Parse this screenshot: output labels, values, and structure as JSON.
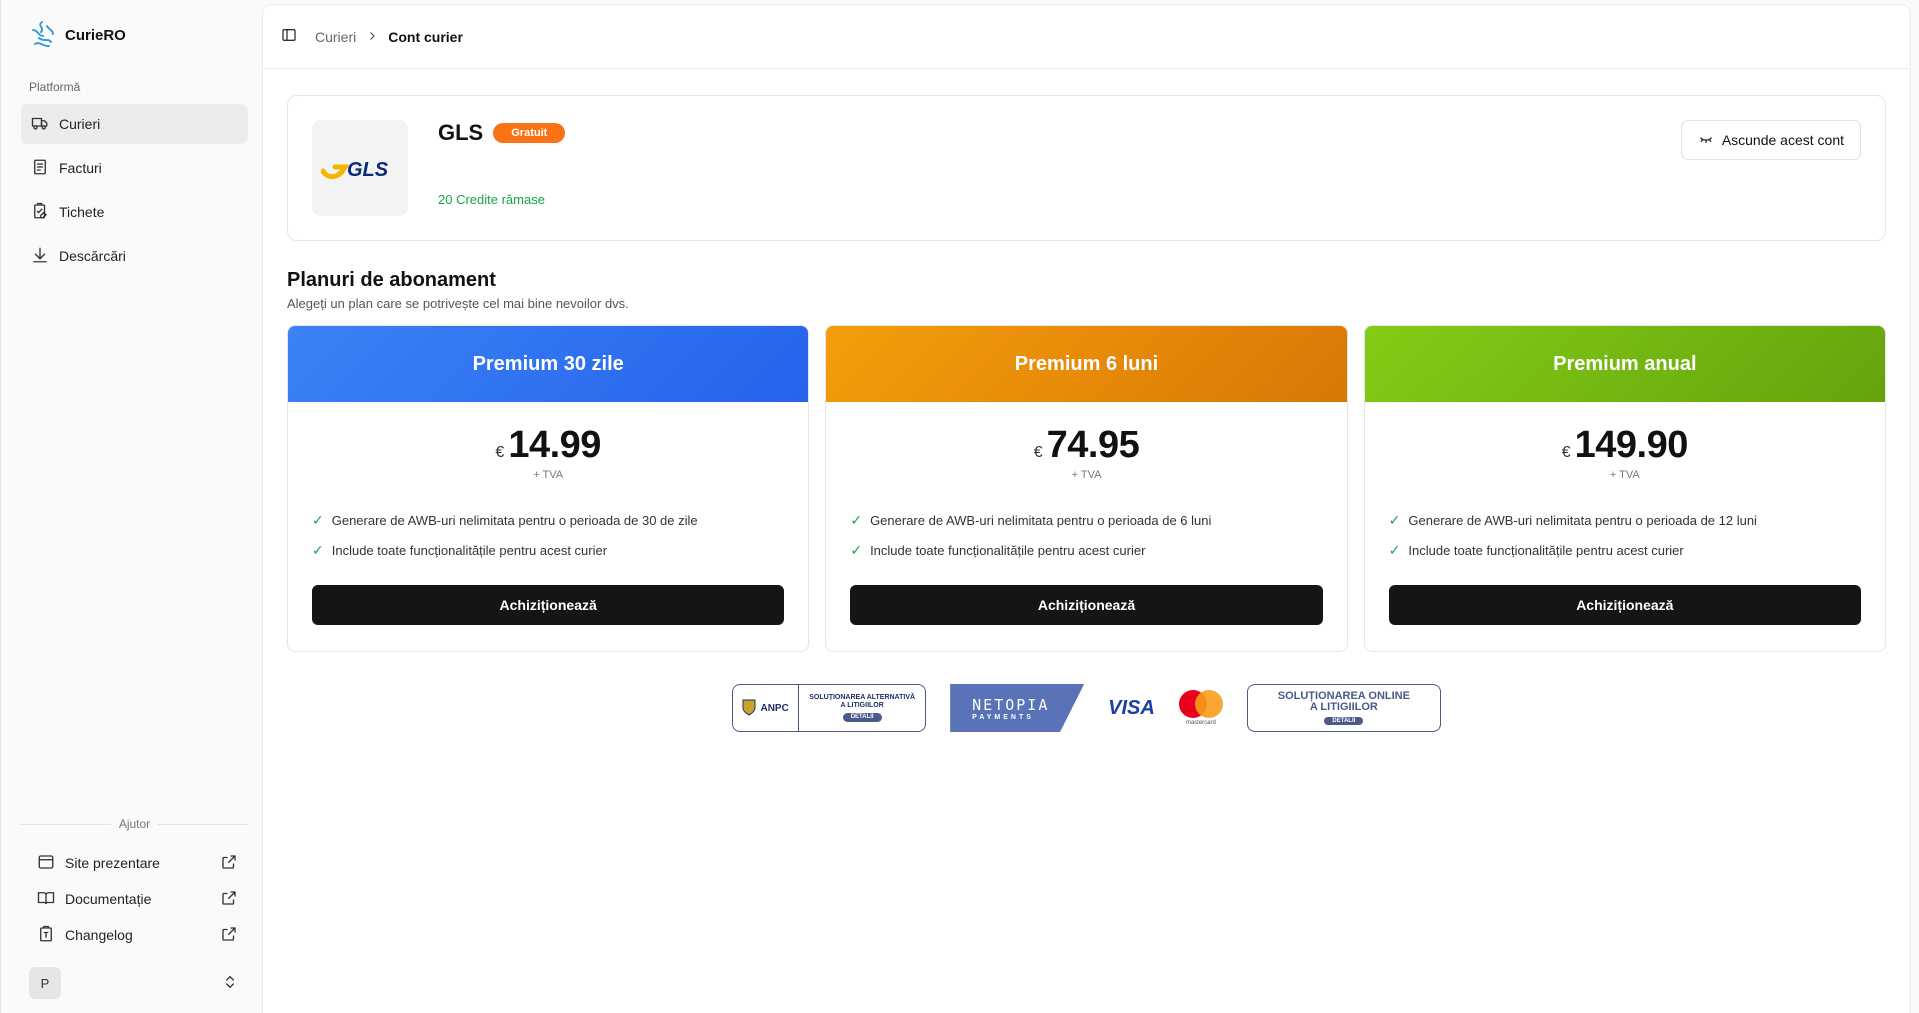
{
  "brand": {
    "name": "CurieRO"
  },
  "sidebar": {
    "section_label": "Platformă",
    "items": [
      {
        "label": "Curieri",
        "icon": "truck-icon",
        "active": true
      },
      {
        "label": "Facturi",
        "icon": "invoice-icon"
      },
      {
        "label": "Tichete",
        "icon": "ticket-icon"
      },
      {
        "label": "Descărcări",
        "icon": "download-icon"
      }
    ],
    "help_label": "Ajutor",
    "links": [
      {
        "label": "Site prezentare",
        "icon": "browser-icon"
      },
      {
        "label": "Documentație",
        "icon": "book-icon"
      },
      {
        "label": "Changelog",
        "icon": "clipboard-icon"
      }
    ],
    "user_initial": "P"
  },
  "breadcrumb": {
    "parent": "Curieri",
    "current": "Cont curier"
  },
  "account": {
    "name": "GLS",
    "logo_text": "GLS",
    "badge": "Gratuit",
    "credits": "20 Credite rămase",
    "hide_label": "Ascunde acest cont"
  },
  "plans_section": {
    "title": "Planuri de abonament",
    "subtitle": "Alegeți un plan care se potrivește cel mai bine nevoilor dvs."
  },
  "plans": [
    {
      "name": "Premium 30 zile",
      "currency": "€",
      "price": "14.99",
      "tax": "+ TVA",
      "features": [
        "Generare de AWB-uri nelimitata pentru o perioada de 30 de zile",
        "Include toate funcționalitățile pentru acest curier"
      ],
      "button": "Achiziționează",
      "color_from": "#3b82f6",
      "color_to": "#2563eb"
    },
    {
      "name": "Premium 6 luni",
      "currency": "€",
      "price": "74.95",
      "tax": "+ TVA",
      "features": [
        "Generare de AWB-uri nelimitata pentru o perioada de 6 luni",
        "Include toate funcționalitățile pentru acest curier"
      ],
      "button": "Achiziționează",
      "color_from": "#f59e0b",
      "color_to": "#d97706"
    },
    {
      "name": "Premium anual",
      "currency": "€",
      "price": "149.90",
      "tax": "+ TVA",
      "features": [
        "Generare de AWB-uri nelimitata pentru o perioada de 12 luni",
        "Include toate funcționalitățile pentru acest curier"
      ],
      "button": "Achiziționează",
      "color_from": "#84cc16",
      "color_to": "#65a30d"
    }
  ],
  "footer_badges": {
    "anpc": {
      "left": "ANPC",
      "right_line1": "SOLUȚIONAREA ALTERNATIVĂ",
      "right_line2": "A LITIGIILOR",
      "pill": "DETALII"
    },
    "netopia": {
      "line1": "NETOPIA",
      "line2": "PAYMENTS"
    },
    "visa": "VISA",
    "mastercard": "mastercard",
    "sol": {
      "line1": "SOLUȚIONAREA ONLINE",
      "line2": "A LITIGIILOR",
      "pill": "DETALII"
    }
  }
}
